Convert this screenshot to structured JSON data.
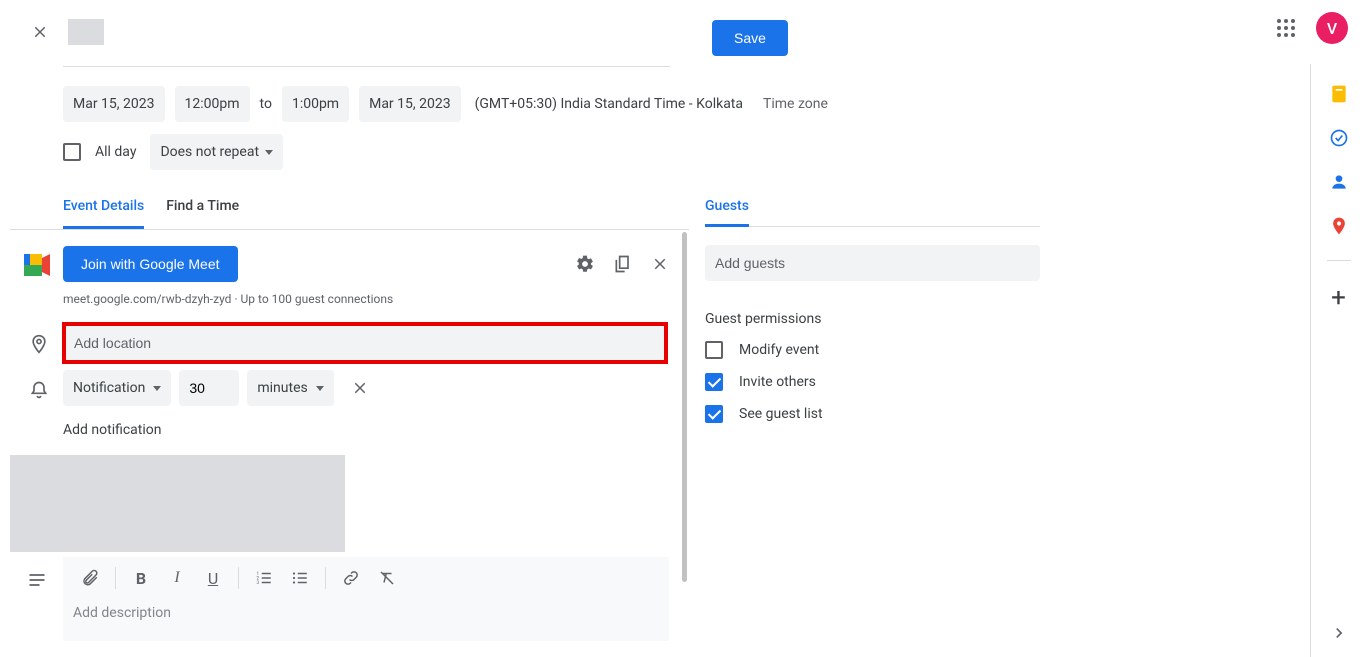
{
  "header": {
    "save_label": "Save",
    "avatar_letter": "V"
  },
  "datetime": {
    "start_date": "Mar 15, 2023",
    "start_time": "12:00pm",
    "to": "to",
    "end_time": "1:00pm",
    "end_date": "Mar 15, 2023",
    "tz_text": "(GMT+05:30) India Standard Time - Kolkata",
    "tz_link": "Time zone",
    "all_day": "All day",
    "repeat": "Does not repeat"
  },
  "tabs": {
    "details": "Event Details",
    "find": "Find a Time"
  },
  "meet": {
    "join_label": "Join with Google Meet",
    "link_text": "meet.google.com/rwb-dzyh-zyd · Up to 100 guest connections"
  },
  "location": {
    "placeholder": "Add location"
  },
  "notification": {
    "type": "Notification",
    "value": "30",
    "unit": "minutes",
    "add": "Add notification"
  },
  "description": {
    "placeholder": "Add description"
  },
  "guests": {
    "tab": "Guests",
    "add_placeholder": "Add guests",
    "perm_title": "Guest permissions",
    "modify": "Modify event",
    "invite": "Invite others",
    "see": "See guest list"
  }
}
